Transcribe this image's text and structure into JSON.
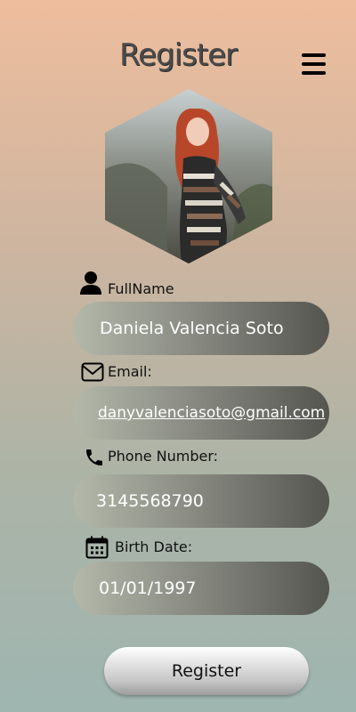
{
  "header": {
    "title": "Register",
    "menu_icon": "hamburger-menu-icon"
  },
  "profile": {
    "avatar_icon": "profile-photo"
  },
  "form": {
    "fullname": {
      "label": "FullName",
      "value": "Daniela Valencia Soto",
      "icon": "user-icon"
    },
    "email": {
      "label": "Email:",
      "value": "danyvalenciasoto@gmail.com",
      "icon": "envelope-icon"
    },
    "phone": {
      "label": "Phone Number:",
      "value": "3145568790",
      "icon": "phone-icon"
    },
    "birth_date": {
      "label": "Birth Date:",
      "value": "01/01/1997",
      "icon": "calendar-icon"
    }
  },
  "actions": {
    "register_label": "Register"
  }
}
